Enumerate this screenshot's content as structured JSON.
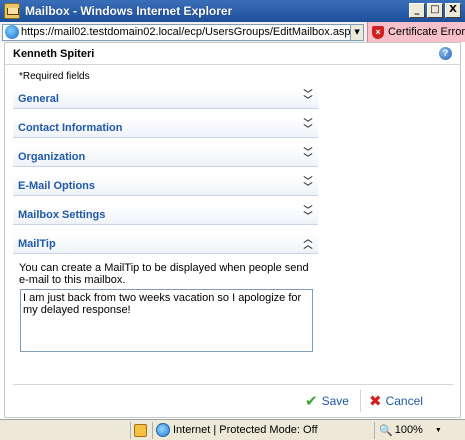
{
  "window": {
    "title": "Mailbox - Windows Internet Explorer",
    "controls": {
      "minimize": "_",
      "maximize": "□",
      "close": "X"
    }
  },
  "address_bar": {
    "url": "https://mail02.testdomain02.local/ecp/UsersGroups/EditMailbox.aspx?id=",
    "dropdown_symbol": "▼",
    "certificate_error": "Certificate Error"
  },
  "header": {
    "name": "Kenneth Spiteri",
    "help_symbol": "?"
  },
  "required_note": "*Required fields",
  "sections": [
    {
      "label": "General",
      "chevron": "⌄⌄"
    },
    {
      "label": "Contact Information",
      "chevron": "⌄⌄"
    },
    {
      "label": "Organization",
      "chevron": "⌄⌄"
    },
    {
      "label": "E-Mail Options",
      "chevron": "⌄⌄"
    },
    {
      "label": "Mailbox Settings",
      "chevron": "⌄⌄"
    },
    {
      "label": "MailTip",
      "chevron": "⌃⌃"
    }
  ],
  "mailtip": {
    "description": "You can create a MailTip to be displayed when people send e-mail to this mailbox.",
    "value": "I am just back from two weeks vacation so I apologize for my delayed response!"
  },
  "buttons": {
    "save": "Save",
    "cancel": "Cancel"
  },
  "status_bar": {
    "zone": "Internet | Protected Mode: Off",
    "zoom": "100%",
    "zoom_dropdown": "▼"
  }
}
